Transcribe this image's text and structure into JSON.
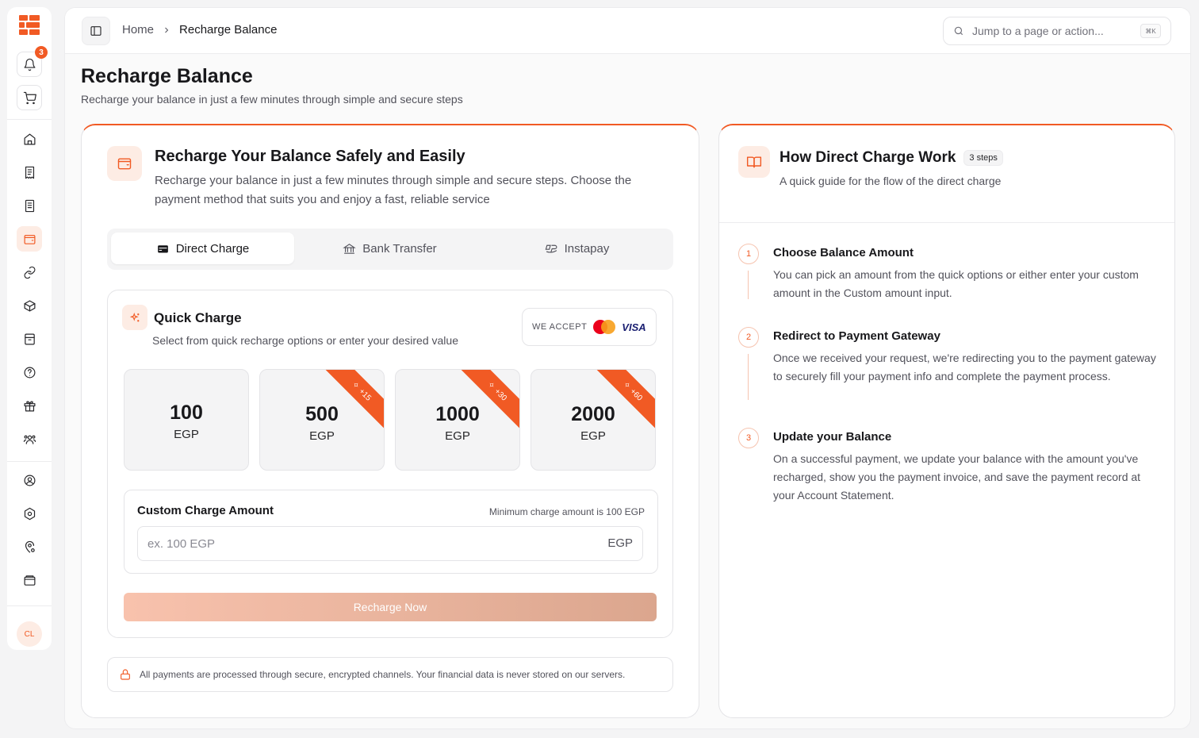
{
  "sidebar": {
    "notification_count": "3",
    "avatar_initials": "CL",
    "nav_icons": [
      "home-icon",
      "receipt-icon",
      "document-icon",
      "wallet-icon",
      "link-icon",
      "box-icon",
      "archive-icon",
      "help-icon",
      "gift-icon",
      "users-icon",
      "user-circle-icon",
      "settings-icon",
      "location-settings-icon",
      "card-wallet-icon"
    ]
  },
  "topbar": {
    "breadcrumb_home": "Home",
    "breadcrumb_current": "Recharge Balance",
    "search_placeholder": "Jump to a page or action...",
    "search_shortcut": "⌘K"
  },
  "page": {
    "title": "Recharge Balance",
    "subtitle": "Recharge your balance in just a few minutes through simple and secure steps"
  },
  "main_card": {
    "title": "Recharge Your Balance Safely and Easily",
    "description": "Recharge your balance in just a few minutes through simple and secure steps. Choose the payment method that suits you and enjoy a fast, reliable service",
    "tabs": [
      {
        "label": "Direct Charge",
        "active": true
      },
      {
        "label": "Bank Transfer",
        "active": false
      },
      {
        "label": "Instapay",
        "active": false
      }
    ],
    "quick_charge": {
      "title": "Quick Charge",
      "subtitle": "Select from quick recharge options or enter your desired value",
      "we_accept": "WE ACCEPT",
      "visa": "VISA",
      "amounts": [
        {
          "value": "100",
          "currency": "EGP",
          "bonus": ""
        },
        {
          "value": "500",
          "currency": "EGP",
          "bonus": "+15"
        },
        {
          "value": "1000",
          "currency": "EGP",
          "bonus": "+30"
        },
        {
          "value": "2000",
          "currency": "EGP",
          "bonus": "+60"
        }
      ],
      "custom_label": "Custom Charge Amount",
      "custom_min": "Minimum charge amount is 100 EGP",
      "custom_placeholder": "ex. 100 EGP",
      "custom_unit": "EGP",
      "recharge_button": "Recharge Now"
    },
    "secure_note": "All payments are processed through secure, encrypted channels. Your financial data is never stored on our servers."
  },
  "guide": {
    "title": "How Direct Charge Work",
    "badge": "3 steps",
    "subtitle": "A quick guide for the flow of the direct charge",
    "steps": [
      {
        "num": "1",
        "title": "Choose Balance Amount",
        "desc": "You can pick an amount from the quick options or either enter your custom amount in the Custom amount input."
      },
      {
        "num": "2",
        "title": "Redirect to Payment Gateway",
        "desc": "Once we received your request, we're redirecting you to the payment gateway to securely fill your payment info and complete the payment process."
      },
      {
        "num": "3",
        "title": "Update your Balance",
        "desc": "On a successful payment, we update your balance with the amount you've recharged, show you the payment invoice, and save the payment record at your Account Statement."
      }
    ]
  },
  "colors": {
    "accent": "#f15a24",
    "accent_soft": "#fdece4",
    "mastercard_red": "#eb001b",
    "mastercard_yellow": "#f79e1b"
  }
}
